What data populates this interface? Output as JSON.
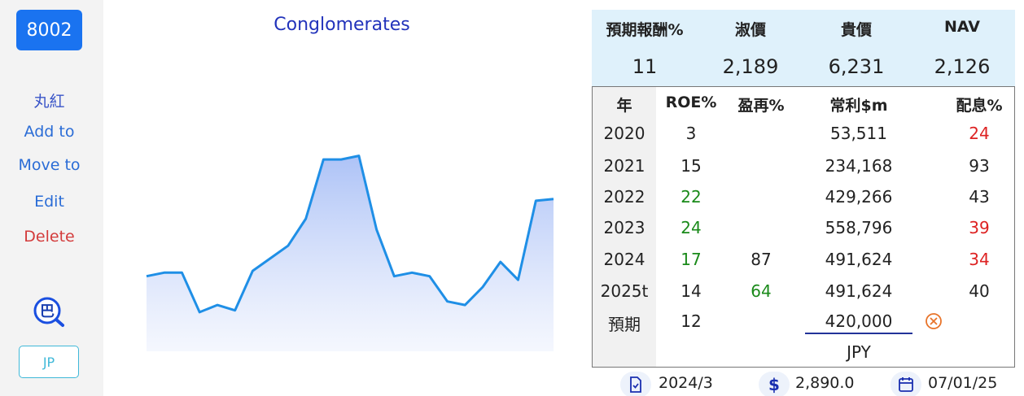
{
  "sidebar": {
    "code": "8002",
    "name": "丸紅",
    "add_to": "Add to",
    "move_to": "Move to",
    "edit": "Edit",
    "delete": "Delete",
    "search_icon_char": "巴",
    "market": "JP"
  },
  "chart": {
    "title": "Conglomerates"
  },
  "chart_data": {
    "type": "area",
    "title": "Conglomerates",
    "xlabel": "",
    "ylabel": "",
    "grid": false,
    "legend": "none",
    "color": "#1f8fe6",
    "y": [
      0.35,
      0.37,
      0.37,
      0.15,
      0.19,
      0.16,
      0.38,
      0.45,
      0.52,
      0.67,
      1.0,
      1.0,
      1.02,
      0.61,
      0.35,
      0.37,
      0.35,
      0.21,
      0.19,
      0.29,
      0.43,
      0.33,
      0.77,
      0.78
    ]
  },
  "stats": {
    "headers": [
      "預期報酬%",
      "淑價",
      "貴價",
      "NAV"
    ],
    "values": [
      "11",
      "2,189",
      "6,231",
      "2,126"
    ]
  },
  "table": {
    "headers": [
      "年",
      "ROE%",
      "盈再%",
      "常利$m",
      "配息%"
    ],
    "rows": [
      {
        "year": "2020",
        "roe": "3",
        "reinvest": "",
        "profit": "53,511",
        "div": "24"
      },
      {
        "year": "2021",
        "roe": "15",
        "reinvest": "",
        "profit": "234,168",
        "div": "93"
      },
      {
        "year": "2022",
        "roe": "22",
        "reinvest": "",
        "profit": "429,266",
        "div": "43"
      },
      {
        "year": "2023",
        "roe": "24",
        "reinvest": "",
        "profit": "558,796",
        "div": "39"
      },
      {
        "year": "2024",
        "roe": "17",
        "reinvest": "87",
        "profit": "491,624",
        "div": "34"
      },
      {
        "year": "2025t",
        "roe": "14",
        "reinvest": "64",
        "profit": "491,624",
        "div": "40"
      }
    ],
    "forecast": {
      "label": "預期",
      "roe": "12",
      "profit_input": "420,000"
    },
    "currency": "JPY"
  },
  "footer": {
    "fiscal": "2024/3",
    "price": "2,890.0",
    "date": "07/01/25"
  },
  "colors": {
    "accent": "#1a73f0",
    "positive": "#1a8a1a",
    "negative": "#dd2222",
    "cancel": "#e8742a"
  }
}
